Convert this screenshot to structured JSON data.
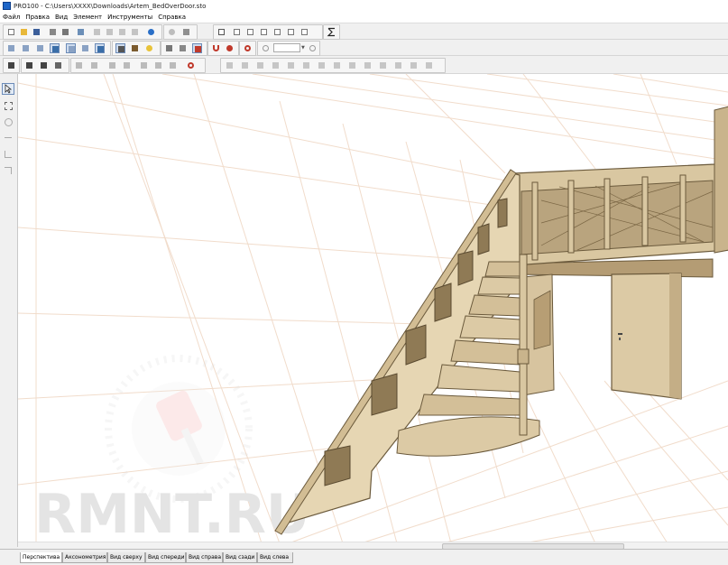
{
  "window": {
    "title": "PRO100 - C:\\Users\\XXXX\\Downloads\\Artem_BedOverDoor.sto"
  },
  "menu": [
    "Файл",
    "Правка",
    "Вид",
    "Элемент",
    "Инструменты",
    "Справка"
  ],
  "toolbar_icons": {
    "row1": [
      "new-file-icon",
      "open-folder-icon",
      "save-icon",
      "print-preview-icon",
      "print-icon",
      "properties-icon",
      "cut-icon",
      "copy-icon",
      "paste-icon",
      "delete-icon",
      "globe-icon",
      "sphere-icon",
      "settings-icon",
      "layout-icon",
      "export-icon",
      "export-icon",
      "export-icon",
      "export-icon",
      "export-icon",
      "export-icon",
      "export-icon",
      "sum-icon"
    ],
    "row2": [
      "view-front-icon",
      "view-left-icon",
      "view-right-icon",
      "view-top-icon",
      "view-back-icon",
      "view-bottom-icon",
      "view-iso-icon",
      "select-tool-icon",
      "light-icon",
      "grid-icon",
      "magnet-icon",
      "snap-icon",
      "zoom-icon"
    ],
    "row3": [
      "grid-icon",
      "move-icon",
      "rotate-icon",
      "mirror-icon",
      "align-icon",
      "align-icon",
      "align-icon",
      "align-icon",
      "align-icon",
      "align-icon",
      "align-icon",
      "align-icon",
      "align-icon"
    ]
  },
  "zoom": {
    "value": ""
  },
  "sidebar_icons": [
    "arrow-cursor-icon",
    "group-select-icon",
    "rotate-tool-icon",
    "measure-tool-icon",
    "dimension-tool-icon",
    "text-tool-icon"
  ],
  "view_tabs": [
    "Перспектива",
    "Аксонометрия",
    "Вид сверху",
    "Вид спереди",
    "Вид справа",
    "Вид сзади",
    "Вид слева"
  ],
  "active_tab": "Перспектива",
  "watermark": {
    "text": "RMNT.RU"
  },
  "colors": {
    "wood": "#dccaa5",
    "wood_dark": "#8f7a55",
    "grid": "#f0d9c8",
    "active_button": "#cfdcee"
  }
}
